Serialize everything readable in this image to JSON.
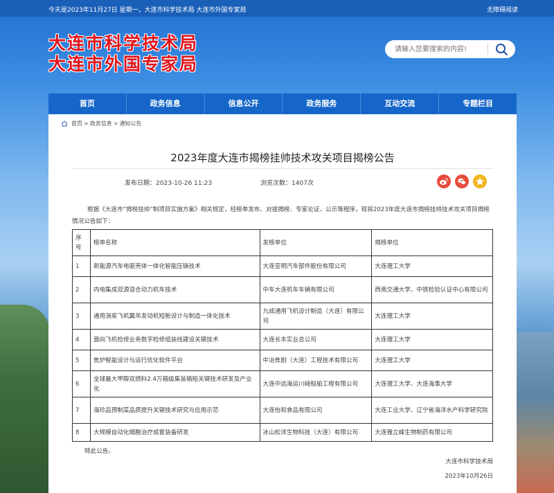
{
  "topbar": {
    "date_text": "今天是2023年11月27日 星期一，大连市科学技术局 大连市外国专家局",
    "accessibility": "无障碍阅读"
  },
  "logo": {
    "line1": "大连市科学技术局",
    "line2": "大连市外国专家局",
    "color": "#e1141b"
  },
  "search": {
    "placeholder": "请输入您要搜索的内容!",
    "icon": "search-icon"
  },
  "nav": {
    "items": [
      "首页",
      "政务信息",
      "信息公开",
      "政务服务",
      "互动交流",
      "专题栏目"
    ],
    "color": "#1566c8"
  },
  "breadcrumb": {
    "home": "首页",
    "sep": ">",
    "level2": "政务信息",
    "level3": "通知公告"
  },
  "article": {
    "title": "2023年度大连市揭榜挂帅技术攻关项目揭榜公告",
    "publish_label": "发布日期：",
    "publish_date": "2023-10-26  11:23",
    "views_label": "浏览次数：",
    "views": "1407次",
    "share_icons": [
      "weibo-icon",
      "wechat-icon",
      "qzone-icon"
    ],
    "intro": "根据《大连市“揭榜挂帅”制项目实施方案》相关规定，经榜单发布、对接揭榜、专家论证、公示等程序，现将2023年度大连市揭榜挂帅技术攻关项目揭榜情况公告如下：",
    "closing": "特此公告。",
    "signature": "大连市科学技术局",
    "sign_date": "2023年10月26日"
  },
  "table": {
    "headers": [
      "序号",
      "榜单名称",
      "发榜单位",
      "揭榜单位"
    ],
    "rows": [
      [
        "1",
        "新能源汽车电驱壳体一体化智能压铸技术",
        "大连亚明汽车部件股份有限公司",
        "大连理工大学"
      ],
      [
        "2",
        "内电集成双源混合动力机车技术",
        "中车大连机车车辆有限公司",
        "西南交通大学、中铁检验认证中心有限公司"
      ],
      [
        "3",
        "通用涡桨飞机翼吊发动机短舱设计与制造一体化技术",
        "九成通用飞机设计制造（大连）有限公司",
        "大连理工大学"
      ],
      [
        "4",
        "面向飞机检修业务数字检修组装线建设关键技术",
        "大连长丰实业总公司",
        "大连理工大学"
      ],
      [
        "5",
        "焦炉智能设计与运行优化软件平台",
        "中冶焦耐（大连）工程技术有限公司",
        "大连理工大学"
      ],
      [
        "6",
        "全球最大甲醇双燃料2.4万箱级集装箱船关键技术研发及产业化",
        "大连中远海运川崎船舶工程有限公司",
        "大连理工大学、大连海事大学"
      ],
      [
        "7",
        "海珍品预制菜品质提升关键技术研究与应用示范",
        "大连怡和食品有限公司",
        "大连工业大学、辽宁省海洋水产科学研究院"
      ],
      [
        "8",
        "大规模自动化细胞治疗成套装备研发",
        "冰山松洋生物科技（大连）有限公司",
        "大连雅立峰生物制药有限公司"
      ]
    ]
  }
}
